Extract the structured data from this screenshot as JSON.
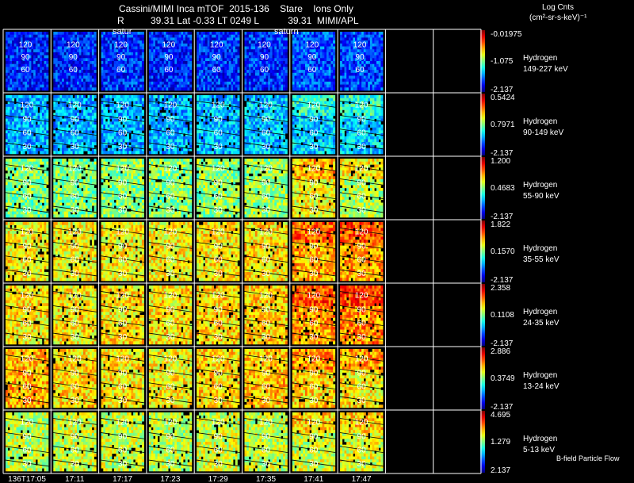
{
  "header": {
    "title_line1": "Cassini/MIMI Inca mTOF  2015-136    Stare    Ions Only",
    "title_line2": "R          39.31 Lat -0.33 LT 0249 L           39.31  MIMI/APL",
    "saturn_labels": [
      "satur",
      "saturn"
    ]
  },
  "colorbar": {
    "title": "Log Cnts",
    "units": "(cm²-sr-s-keV)⁻¹"
  },
  "footer": {
    "b_field_label": "B-field Particle Flow"
  },
  "chart_data": {
    "type": "heatmap",
    "time_labels": [
      "136T17:05",
      "17:11",
      "17:17",
      "17:23",
      "17:29",
      "17:35",
      "17:41",
      "17:47"
    ],
    "contour_labels": [
      "120",
      "90",
      "60",
      "30"
    ],
    "rows": [
      {
        "species": "Hydrogen",
        "energy": "149-227 keV",
        "max_label": "-0.01975",
        "mid_label": "-1.075",
        "min_label": "-2.137",
        "vmin": -2.137,
        "vmax": -0.01975,
        "level": [
          0.14,
          0.14,
          0.15,
          0.14,
          0.15,
          0.15,
          0.18,
          0.17
        ],
        "show_contours": false
      },
      {
        "species": "Hydrogen",
        "energy": "90-149 keV",
        "max_label": "0.5424",
        "mid_label": "0.7971",
        "min_label": "-2.137",
        "vmin": -2.137,
        "vmax": 0.5424,
        "level": [
          0.3,
          0.3,
          0.3,
          0.3,
          0.31,
          0.32,
          0.33,
          0.33
        ],
        "show_contours": true
      },
      {
        "species": "Hydrogen",
        "energy": "55-90 keV",
        "max_label": "1.200",
        "mid_label": "0.4683",
        "min_label": "-2.137",
        "vmin": -2.137,
        "vmax": 1.2,
        "level": [
          0.5,
          0.5,
          0.51,
          0.51,
          0.52,
          0.53,
          0.62,
          0.55
        ],
        "show_contours": true
      },
      {
        "species": "Hydrogen",
        "energy": "35-55 keV",
        "max_label": "1.822",
        "mid_label": "0.1570",
        "min_label": "-2.137",
        "vmin": -2.137,
        "vmax": 1.822,
        "level": [
          0.63,
          0.62,
          0.63,
          0.63,
          0.64,
          0.65,
          0.7,
          0.72
        ],
        "show_contours": true
      },
      {
        "species": "Hydrogen",
        "energy": "24-35 keV",
        "max_label": "2.358",
        "mid_label": "0.1108",
        "min_label": "-2.137",
        "vmin": -2.137,
        "vmax": 2.358,
        "level": [
          0.64,
          0.64,
          0.65,
          0.65,
          0.66,
          0.67,
          0.72,
          0.74
        ],
        "show_contours": true
      },
      {
        "species": "Hydrogen",
        "energy": "13-24 keV",
        "max_label": "2.886",
        "mid_label": "0.3749",
        "min_label": "-2.137",
        "vmin": -2.137,
        "vmax": 2.886,
        "level": [
          0.7,
          0.66,
          0.64,
          0.63,
          0.66,
          0.68,
          0.66,
          0.64
        ],
        "show_contours": true
      },
      {
        "species": "Hydrogen",
        "energy": "5-13 keV",
        "max_label": "4.695",
        "mid_label": "1.279",
        "min_label": "2.137",
        "vmin": -2.137,
        "vmax": 4.695,
        "level": [
          0.56,
          0.58,
          0.57,
          0.56,
          0.58,
          0.57,
          0.58,
          0.59
        ],
        "show_contours": true
      }
    ]
  },
  "colors": {
    "grid": "#ffffff",
    "contour": "#000000",
    "background": "#000000"
  }
}
